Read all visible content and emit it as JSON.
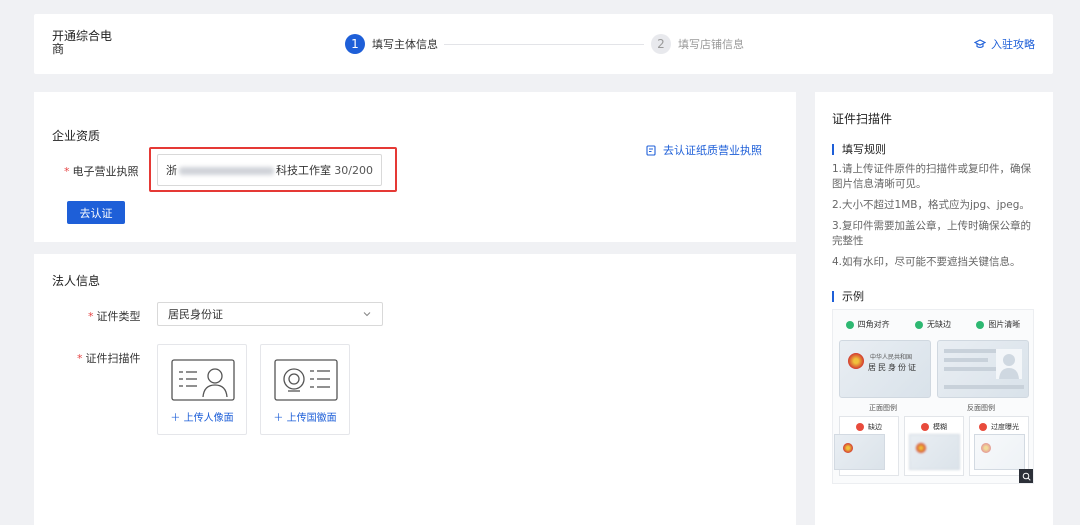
{
  "header": {
    "app_title": "开通综合电商",
    "steps": [
      {
        "number": "1",
        "label": "填写主体信息"
      },
      {
        "number": "2",
        "label": "填写店铺信息"
      }
    ],
    "guide_link": "入驻攻略"
  },
  "company": {
    "section_title": "企业资质",
    "license_label": "电子营业执照",
    "license_value_start": "浙",
    "license_value_end": "科技工作室",
    "license_count": "30/200",
    "verify_button": "去认证",
    "paper_link": "去认证纸质营业执照"
  },
  "legal": {
    "section_title": "法人信息",
    "cert_type_label": "证件类型",
    "cert_type_value": "居民身份证",
    "scan_label": "证件扫描件",
    "upload_portrait": "上传人像面",
    "upload_emblem": "上传国徽面"
  },
  "side": {
    "title": "证件扫描件",
    "rules_title": "填写规则",
    "rules": [
      "1.请上传证件原件的扫描件或复印件，确保图片信息清晰可见。",
      "2.大小不超过1MB，格式应为jpg、jpeg。",
      "3.复印件需要加盖公章，上传时确保公章的完整性",
      "4.如有水印，尽可能不要遮挡关键信息。"
    ],
    "example_title": "示例",
    "example": {
      "checks": [
        "四角对齐",
        "无缺边",
        "图片清晰"
      ],
      "card_country": "中华人民共和国",
      "card_name": "居民身份证",
      "front_caption": "正面图例",
      "back_caption": "反面图例",
      "bad": [
        "缺边",
        "模糊",
        "过度曝光"
      ]
    }
  },
  "colors": {
    "primary": "#1e5fd8",
    "highlight": "#e53935",
    "required": "#e64545"
  }
}
